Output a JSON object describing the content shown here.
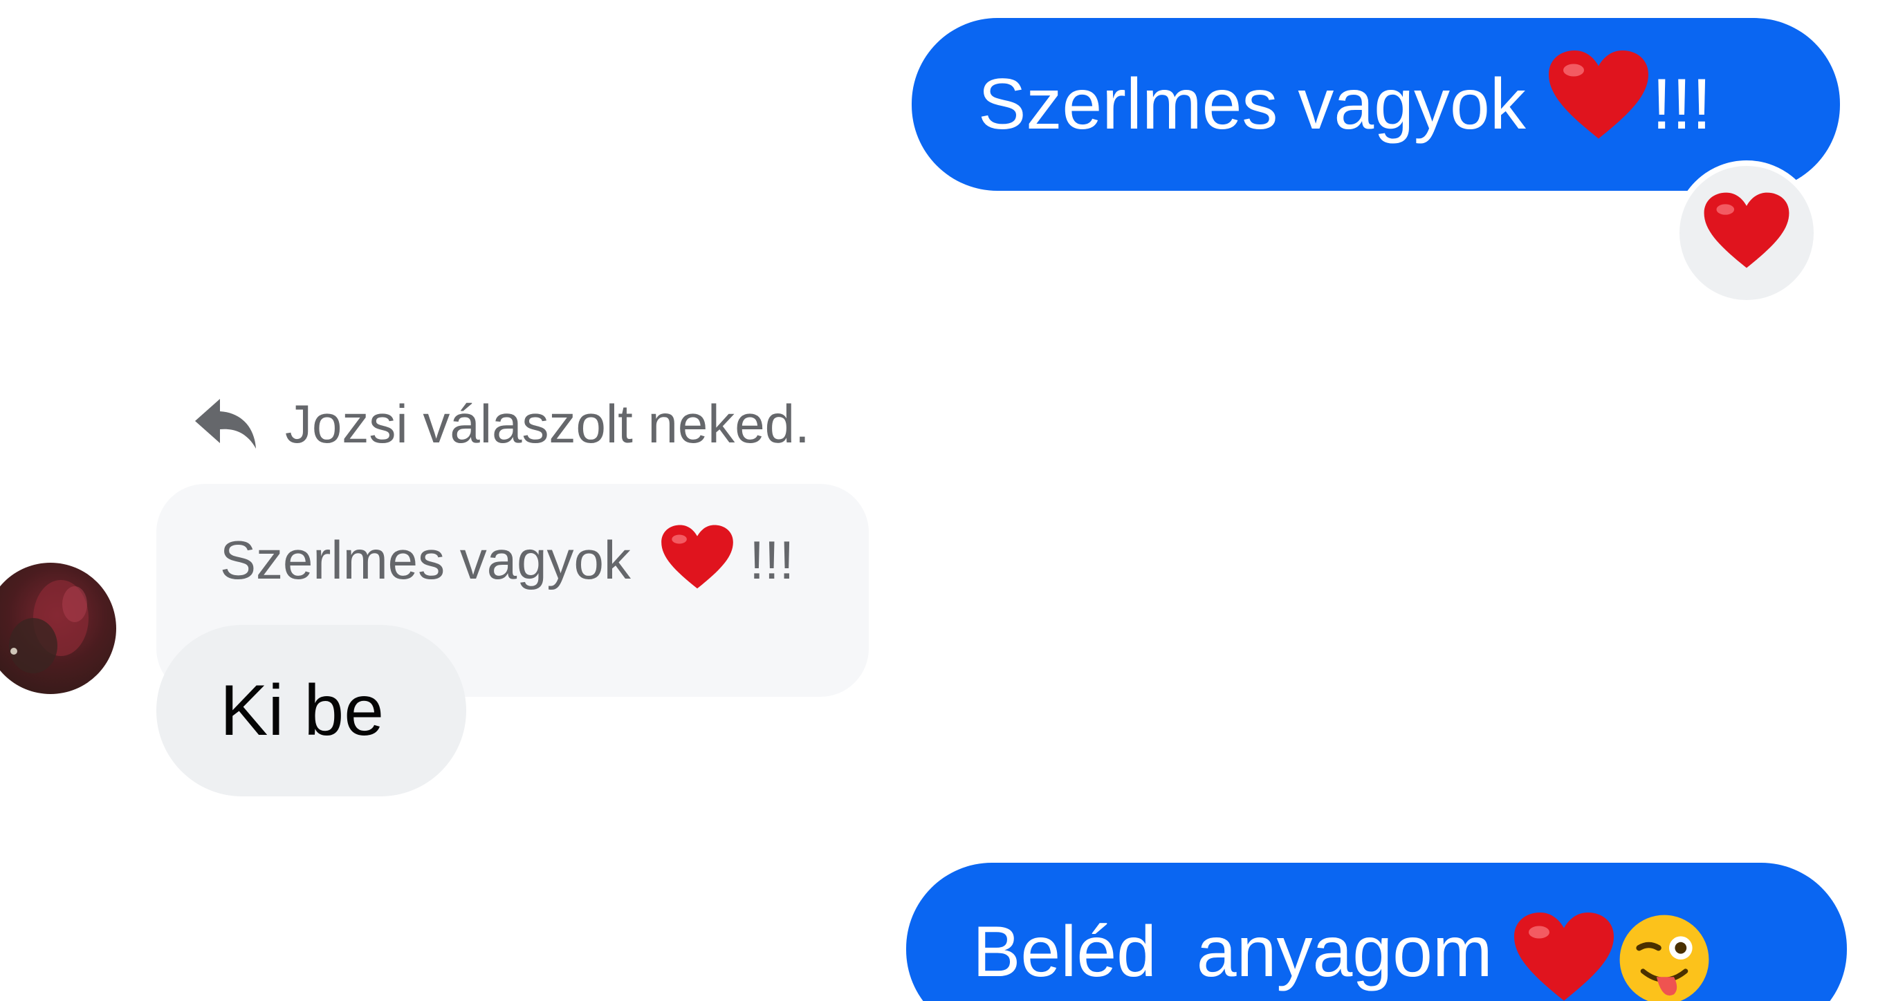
{
  "conversation": {
    "messages": [
      {
        "id": "out-1",
        "text": "Szerlmes vagyok",
        "suffix": "!!!"
      },
      {
        "id": "in-1",
        "reply_note": "Jozsi válaszolt neked.",
        "quoted_text": "Szerlmes vagyok",
        "quoted_suffix": "!!!",
        "text": "Ki be"
      },
      {
        "id": "out-2",
        "text": "Beléd  anyagom"
      }
    ],
    "reaction": {
      "emoji": "heart"
    },
    "icons": {
      "reply": "reply-arrow-icon",
      "heart": "heart-emoji",
      "wink": "winking-tongue-emoji"
    },
    "colors": {
      "outgoing_bubble": "#0a66f2",
      "incoming_bubble": "#eef0f2",
      "quoted_bubble": "#f6f7f9",
      "muted_text": "#65676b",
      "heart": "#e0141e"
    }
  }
}
